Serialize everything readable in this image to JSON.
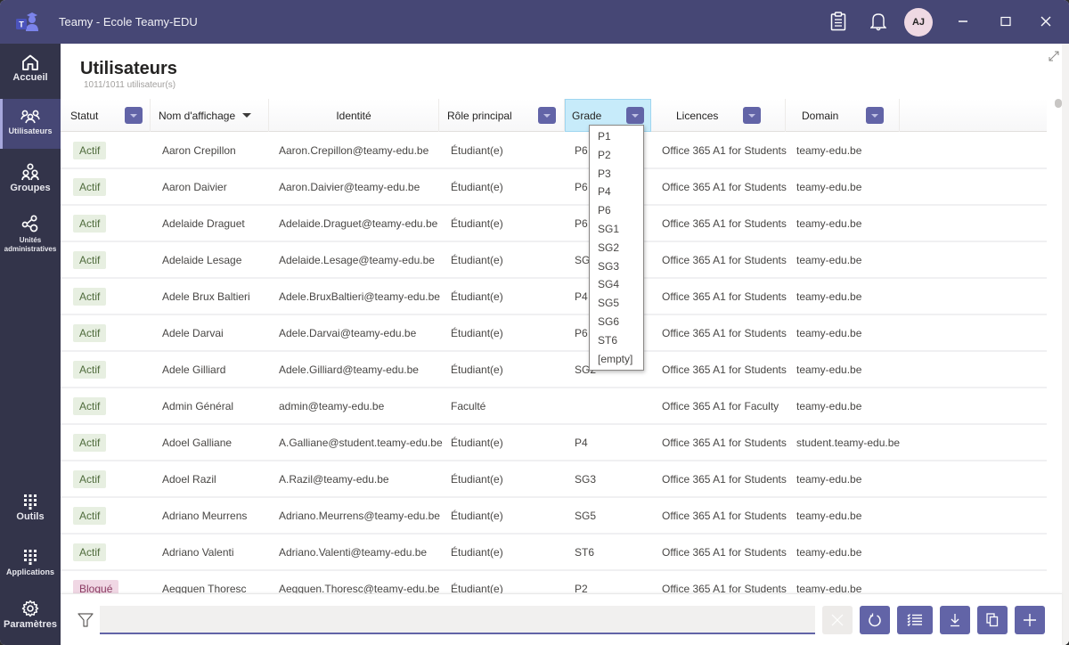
{
  "window": {
    "title": "Teamy - Ecole Teamy-EDU",
    "user_initials": "AJ"
  },
  "colors": {
    "titlebar": "#464775",
    "rail": "#33344a",
    "accent": "#6264a7",
    "status_active_bg": "#e7efe1",
    "status_blocked_bg": "#f0d7e4"
  },
  "rail": {
    "items": [
      {
        "label": "Accueil",
        "icon": "home-icon"
      },
      {
        "label": "Utilisateurs",
        "icon": "users-icon",
        "active": true
      },
      {
        "label": "Groupes",
        "icon": "groups-icon"
      },
      {
        "label": "Unités administratives",
        "icon": "org-units-icon"
      }
    ],
    "bottom_items": [
      {
        "label": "Outils",
        "icon": "tools-grid-icon"
      },
      {
        "label": "Applications",
        "icon": "apps-grid-icon"
      },
      {
        "label": "Paramètres",
        "icon": "gear-icon"
      }
    ]
  },
  "page": {
    "title": "Utilisateurs",
    "count": "1011/1011 utilisateur(s)"
  },
  "table": {
    "columns": [
      {
        "label": "Statut",
        "filter": true
      },
      {
        "label": "Nom d'affichage",
        "sorted": "desc"
      },
      {
        "label": "Identité"
      },
      {
        "label": "Rôle principal",
        "filter": true
      },
      {
        "label": "Grade",
        "filter": true,
        "active": true
      },
      {
        "label": "Licences",
        "filter": true
      },
      {
        "label": "Domain",
        "filter": true
      }
    ],
    "rows": [
      {
        "status": "Actif",
        "name": "Aaron Crepillon",
        "identity": "Aaron.Crepillon@teamy-edu.be",
        "role": "Étudiant(e)",
        "grade": "P6",
        "license": "Office 365 A1 for Students",
        "domain": "teamy-edu.be"
      },
      {
        "status": "Actif",
        "name": "Aaron Daivier",
        "identity": "Aaron.Daivier@teamy-edu.be",
        "role": "Étudiant(e)",
        "grade": "P6",
        "license": "Office 365 A1 for Students",
        "domain": "teamy-edu.be"
      },
      {
        "status": "Actif",
        "name": "Adelaide Draguet",
        "identity": "Adelaide.Draguet@teamy-edu.be",
        "role": "Étudiant(e)",
        "grade": "P6",
        "license": "Office 365 A1 for Students",
        "domain": "teamy-edu.be"
      },
      {
        "status": "Actif",
        "name": "Adelaide Lesage",
        "identity": "Adelaide.Lesage@teamy-edu.be",
        "role": "Étudiant(e)",
        "grade": "SG4",
        "license": "Office 365 A1 for Students",
        "domain": "teamy-edu.be"
      },
      {
        "status": "Actif",
        "name": "Adele Brux Baltieri",
        "identity": "Adele.BruxBaltieri@teamy-edu.be",
        "role": "Étudiant(e)",
        "grade": "P4",
        "license": "Office 365 A1 for Students",
        "domain": "teamy-edu.be"
      },
      {
        "status": "Actif",
        "name": "Adele Darvai",
        "identity": "Adele.Darvai@teamy-edu.be",
        "role": "Étudiant(e)",
        "grade": "P6",
        "license": "Office 365 A1 for Students",
        "domain": "teamy-edu.be"
      },
      {
        "status": "Actif",
        "name": "Adele Gilliard",
        "identity": "Adele.Gilliard@teamy-edu.be",
        "role": "Étudiant(e)",
        "grade": "SG2",
        "license": "Office 365 A1 for Students",
        "domain": "teamy-edu.be"
      },
      {
        "status": "Actif",
        "name": "Admin Général",
        "identity": "admin@teamy-edu.be",
        "role": "Faculté",
        "grade": "",
        "license": "Office 365 A1 for Faculty",
        "domain": "teamy-edu.be"
      },
      {
        "status": "Actif",
        "name": "Adoel Galliane",
        "identity": "A.Galliane@student.teamy-edu.be",
        "role": "Étudiant(e)",
        "grade": "P4",
        "license": "Office 365 A1 for Students",
        "domain": "student.teamy-edu.be"
      },
      {
        "status": "Actif",
        "name": "Adoel Razil",
        "identity": "A.Razil@teamy-edu.be",
        "role": "Étudiant(e)",
        "grade": "SG3",
        "license": "Office 365 A1 for Students",
        "domain": "teamy-edu.be"
      },
      {
        "status": "Actif",
        "name": "Adriano Meurrens",
        "identity": "Adriano.Meurrens@teamy-edu.be",
        "role": "Étudiant(e)",
        "grade": "SG5",
        "license": "Office 365 A1 for Students",
        "domain": "teamy-edu.be"
      },
      {
        "status": "Actif",
        "name": "Adriano Valenti",
        "identity": "Adriano.Valenti@teamy-edu.be",
        "role": "Étudiant(e)",
        "grade": "ST6",
        "license": "Office 365 A1 for Students",
        "domain": "teamy-edu.be"
      },
      {
        "status": "Bloqué",
        "name": "Aegguen Thoresc",
        "identity": "Aegguen.Thoresc@teamy-edu.be",
        "role": "Étudiant(e)",
        "grade": "P2",
        "license": "Office 365 A1 for Students",
        "domain": "teamy-edu.be"
      }
    ]
  },
  "grade_filter_options": [
    "P1",
    "P2",
    "P3",
    "P4",
    "P6",
    "SG1",
    "SG2",
    "SG3",
    "SG4",
    "SG5",
    "SG6",
    "ST6",
    "[empty]"
  ],
  "footer": {
    "filter_value": "",
    "filter_placeholder": "",
    "buttons": [
      "clear",
      "refresh",
      "columns",
      "download",
      "copy",
      "add"
    ]
  }
}
